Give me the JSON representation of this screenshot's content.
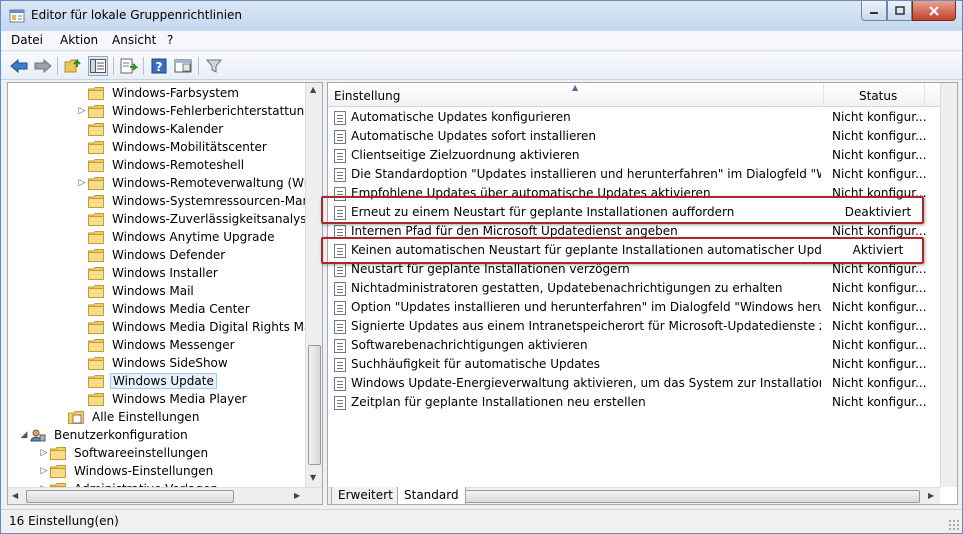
{
  "window": {
    "title": "Editor für lokale Gruppenrichtlinien",
    "colors": {
      "title_gradient_top": "#dbe8f6",
      "close_red": "#c2412a",
      "highlight_box": "#b0242a"
    }
  },
  "menu": [
    "Datei",
    "Aktion",
    "Ansicht",
    "?"
  ],
  "toolbar": [
    "back-arrow-icon",
    "forward-arrow-icon",
    "up-folder-icon",
    "show-hide-tree-icon",
    "export-list-icon",
    "help-icon",
    "properties-view-icon",
    "filter-icon"
  ],
  "tree": {
    "items": [
      {
        "label": "Windows-Farbsystem",
        "expander": ""
      },
      {
        "label": "Windows-Fehlerberichterstattung",
        "expander": "▷"
      },
      {
        "label": "Windows-Kalender",
        "expander": ""
      },
      {
        "label": "Windows-Mobilitätscenter",
        "expander": ""
      },
      {
        "label": "Windows-Remoteshell",
        "expander": ""
      },
      {
        "label": "Windows-Remoteverwaltung (WinRM)",
        "expander": "▷"
      },
      {
        "label": "Windows-Systemressourcen-Manager",
        "expander": ""
      },
      {
        "label": "Windows-Zuverlässigkeitsanalyse",
        "expander": ""
      },
      {
        "label": "Windows Anytime Upgrade",
        "expander": ""
      },
      {
        "label": "Windows Defender",
        "expander": ""
      },
      {
        "label": "Windows Installer",
        "expander": ""
      },
      {
        "label": "Windows Mail",
        "expander": ""
      },
      {
        "label": "Windows Media Center",
        "expander": ""
      },
      {
        "label": "Windows Media Digital Rights Management",
        "expander": ""
      },
      {
        "label": "Windows Messenger",
        "expander": ""
      },
      {
        "label": "Windows SideShow",
        "expander": ""
      },
      {
        "label": "Windows Update",
        "expander": "",
        "selected": true
      },
      {
        "label": "Windows Media Player",
        "expander": ""
      }
    ],
    "all_settings": "Alle Einstellungen",
    "user_config": "Benutzerkonfiguration",
    "user_children": [
      {
        "label": "Softwareeinstellungen",
        "expander": "▷"
      },
      {
        "label": "Windows-Einstellungen",
        "expander": "▷"
      },
      {
        "label": "Administrative Vorlagen",
        "expander": "▷"
      }
    ]
  },
  "list": {
    "col_setting": "Einstellung",
    "col_status": "Status",
    "rows": [
      {
        "name": "Automatische Updates konfigurieren",
        "status": "Nicht konfigur..."
      },
      {
        "name": "Automatische Updates sofort installieren",
        "status": "Nicht konfigur..."
      },
      {
        "name": "Clientseitige Zielzuordnung aktivieren",
        "status": "Nicht konfigur..."
      },
      {
        "name": "Die Standardoption \"Updates installieren und herunterfahren\" im Dialogfeld \"Windows ...",
        "status": "Nicht konfigur..."
      },
      {
        "name": "Empfohlene Updates über automatische Updates aktivieren",
        "status": "Nicht konfigur..."
      },
      {
        "name": "Erneut zu einem Neustart für geplante Installationen auffordern",
        "status": "Deaktiviert",
        "center": true
      },
      {
        "name": "Internen Pfad für den Microsoft Updatedienst angeben",
        "status": "Nicht konfigur..."
      },
      {
        "name": "Keinen automatischen Neustart für geplante Installationen automatischer Updates durc...",
        "status": "Aktiviert",
        "center": true
      },
      {
        "name": "Neustart für geplante Installationen verzögern",
        "status": "Nicht konfigur..."
      },
      {
        "name": "Nichtadministratoren gestatten, Updatebenachrichtigungen zu erhalten",
        "status": "Nicht konfigur..."
      },
      {
        "name": "Option \"Updates installieren und herunterfahren\" im Dialogfeld \"Windows herunterfahr...",
        "status": "Nicht konfigur..."
      },
      {
        "name": "Signierte Updates aus einem Intranetspeicherort für Microsoft-Updatedienste zulassen",
        "status": "Nicht konfigur..."
      },
      {
        "name": "Softwarebenachrichtigungen aktivieren",
        "status": "Nicht konfigur..."
      },
      {
        "name": "Suchhäufigkeit für automatische Updates",
        "status": "Nicht konfigur..."
      },
      {
        "name": "Windows Update-Energieverwaltung aktivieren, um das System zur Installation von gepl...",
        "status": "Nicht konfigur..."
      },
      {
        "name": "Zeitplan für geplante Installationen neu erstellen",
        "status": "Nicht konfigur..."
      }
    ]
  },
  "tabs": {
    "extended": "Erweitert",
    "standard": "Standard"
  },
  "status_bar": "16 Einstellung(en)"
}
